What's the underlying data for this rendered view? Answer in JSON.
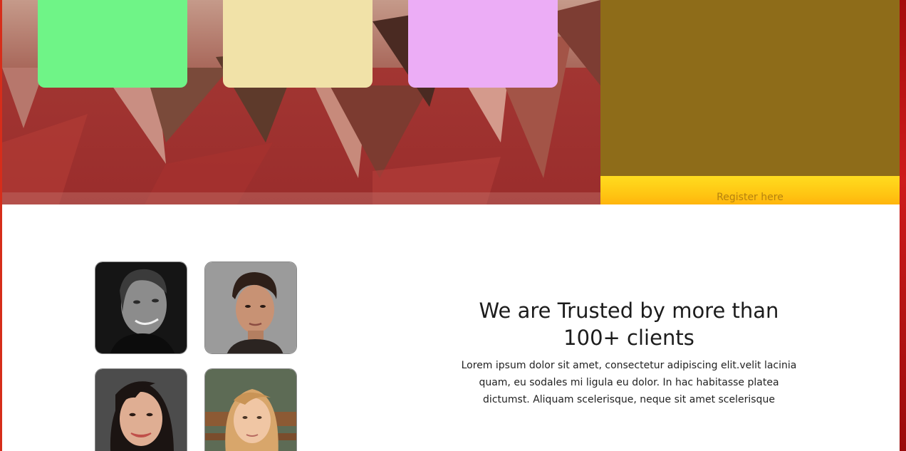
{
  "hero": {
    "cards": [
      {
        "name": "green-card",
        "color": "#6ff487"
      },
      {
        "name": "cream-card",
        "color": "#f1e2a8"
      },
      {
        "name": "pink-card",
        "color": "#ecadf6"
      }
    ]
  },
  "register_panel": {
    "color": "#8e6c19",
    "button_label": "Register here"
  },
  "trusted": {
    "heading": "We are Trusted by more than 100+ clients",
    "body": "Lorem ipsum dolor sit amet, consectetur adipiscing elit.velit lacinia quam, eu sodales mi ligula eu dolor. In hac habitasse platea dictumst. Aliquam scelerisque, neque sit amet scelerisque"
  },
  "clients": [
    {
      "name": "client-avatar-1"
    },
    {
      "name": "client-avatar-2"
    },
    {
      "name": "client-avatar-3"
    },
    {
      "name": "client-avatar-4"
    }
  ]
}
